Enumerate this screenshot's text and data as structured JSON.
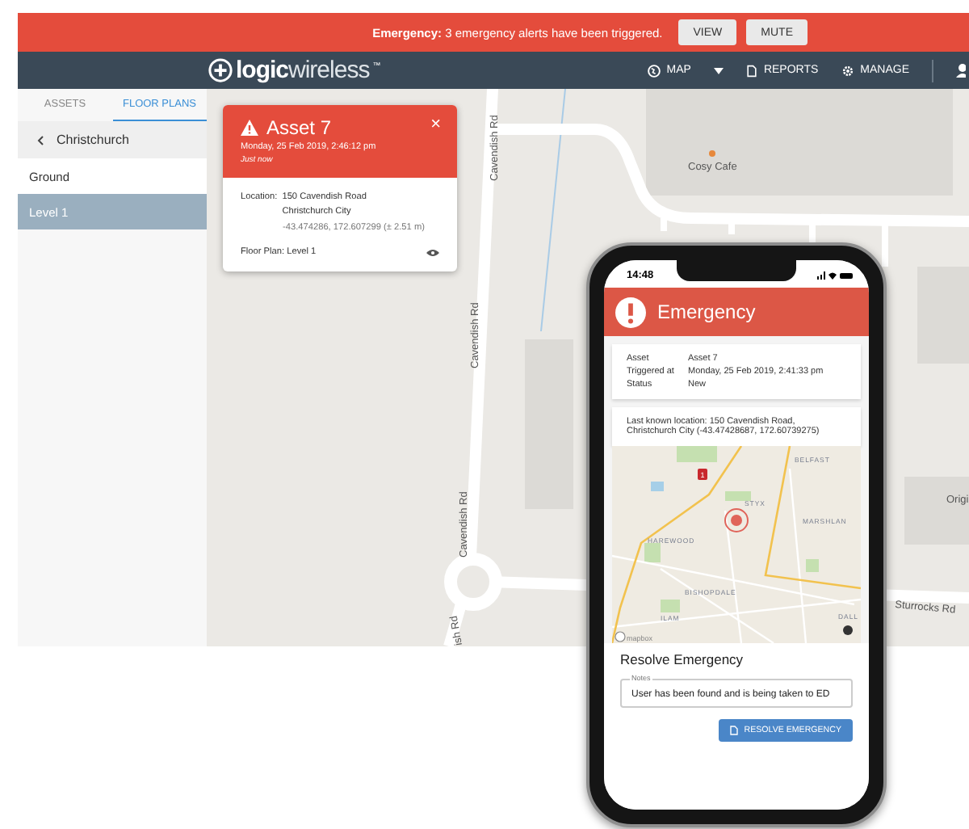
{
  "alert_banner": {
    "strong": "Emergency:",
    "message": "3 emergency alerts have been triggered.",
    "buttons": [
      "VIEW",
      "MUTE"
    ]
  },
  "navbar": {
    "logo_bold": "logic",
    "logo_light": "wireless",
    "logo_tm": "™",
    "items": [
      {
        "label": "MAP",
        "dropdown": true
      },
      {
        "label": "REPORTS",
        "dropdown": false
      },
      {
        "label": "MANAGE",
        "dropdown": false
      }
    ]
  },
  "sidebar": {
    "tabs": [
      {
        "label": "ASSETS",
        "selected": false
      },
      {
        "label": "FLOOR PLANS",
        "selected": true
      }
    ],
    "back_label": "Christchurch",
    "items": [
      {
        "label": "Ground",
        "selected": false
      },
      {
        "label": "Level 1",
        "selected": true
      }
    ]
  },
  "alert_card": {
    "title": "Asset 7",
    "timestamp": "Monday, 25 Feb 2019, 2:46:12 pm",
    "relative_time": "Just now",
    "close": "×",
    "location_label": "Location:",
    "address_lines": [
      "150 Cavendish Road",
      "Christchurch City"
    ],
    "coordinates": "-43.474286, 172.607299 (± 2.51 m)",
    "floor_plan": "Floor Plan: Level 1"
  },
  "map": {
    "labels": [
      "Cavendish Rd",
      "Cavendish Rd",
      "Cavendish Rd",
      "ish Rd",
      "Cosy Cafe",
      "Sturrocks Rd",
      "Origi"
    ]
  },
  "phone": {
    "status_time": "14:48",
    "header": "Emergency",
    "details": [
      {
        "label": "Asset",
        "value": "Asset 7"
      },
      {
        "label": "Triggered at",
        "value": "Monday, 25 Feb 2019, 2:41:33 pm"
      },
      {
        "label": "Status",
        "value": "New"
      }
    ],
    "location_text": "Last known location: 150 Cavendish Road, Christchurch City (-43.47428687, 172.60739275)",
    "map_labels": [
      "BELFAST",
      "STYX",
      "MARSHLAN",
      "HAREWOOD",
      "BISHOPDALE",
      "ILAM",
      "DALL"
    ],
    "map_attribution": "mapbox",
    "highway_marker": "1",
    "resolve_title": "Resolve Emergency",
    "notes_label": "Notes",
    "notes_value": "User has been found and is being taken to ED",
    "resolve_button": "RESOLVE EMERGENCY"
  }
}
